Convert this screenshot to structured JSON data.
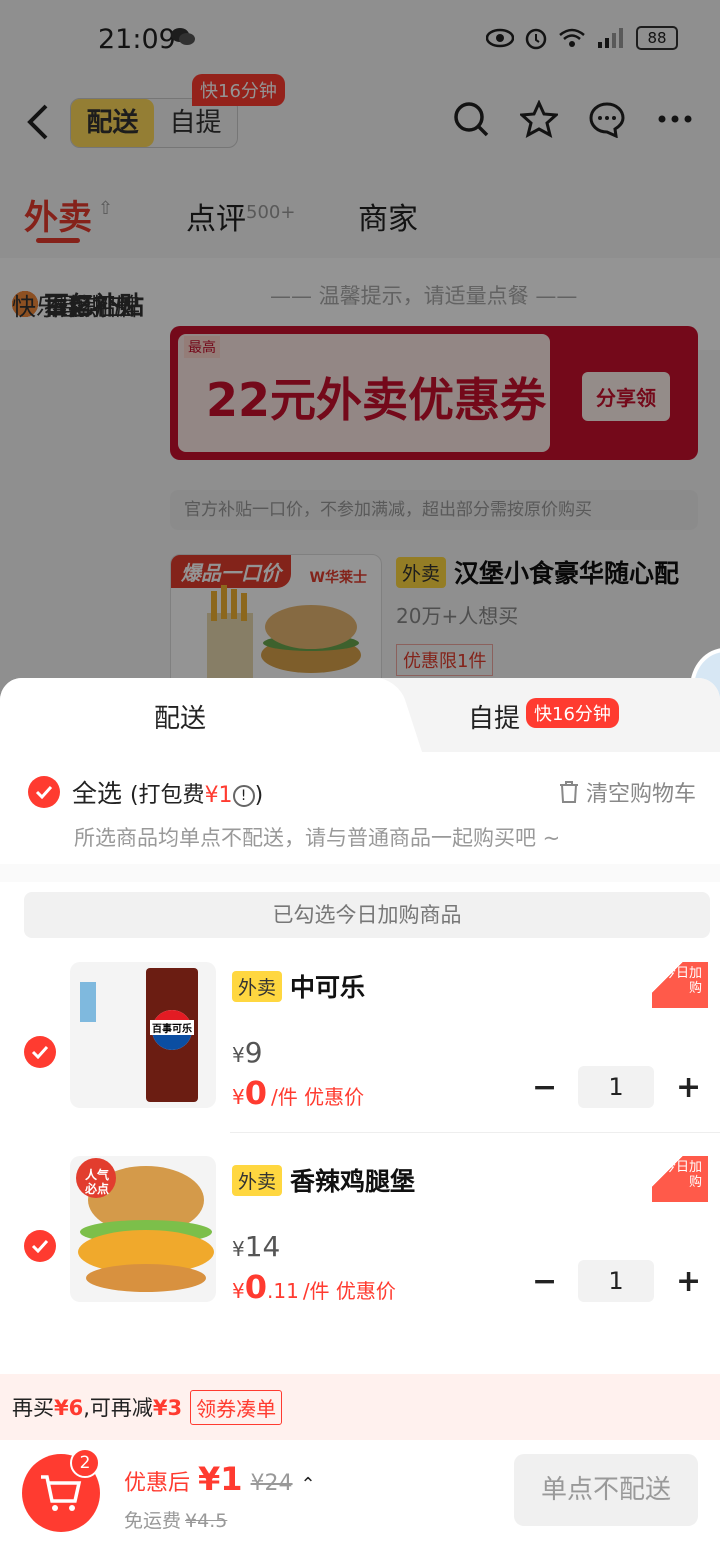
{
  "status": {
    "time": "21:09",
    "battery": "88",
    "network": "4G"
  },
  "header": {
    "mode_delivery": "配送",
    "mode_pickup": "自提",
    "fast_tag": "快16分钟"
  },
  "tabs": [
    {
      "label": "外卖"
    },
    {
      "label": "点评",
      "badge": "500+"
    },
    {
      "label": "商家"
    }
  ],
  "sidebar": {
    "items": [
      {
        "label": "百亿补贴"
      },
      {
        "label": "本店招牌"
      },
      {
        "label": "推荐"
      },
      {
        "label": "折扣"
      },
      {
        "label": "快乐星期五"
      }
    ]
  },
  "store": {
    "tip": "—— 温馨提示，请适量点餐 ——",
    "coupon": {
      "top": "最高",
      "title": "22元外卖优惠券",
      "share": "分享领"
    },
    "rule": "官方补贴一口价，不参加满减，超出部分需按原价购买",
    "product": {
      "ribbon": "爆品一口价",
      "brand": "W华莱士",
      "tag": "外卖",
      "name": "汉堡小食豪华随心配",
      "sub": "20万+人想买",
      "limit": "优惠限1件"
    }
  },
  "sheet": {
    "tab_delivery": "配送",
    "tab_pickup": "自提",
    "tab_pickup_badge": "快16分钟",
    "select_all": "全选",
    "packing_fee_prefix": "(打包费",
    "packing_fee_value": "¥1",
    "packing_fee_suffix": ")",
    "clear": "清空购物车",
    "note": "所选商品均单点不配送，请与普通商品一起购买吧 ~",
    "addon_header": "已勾选今日加购商品",
    "items": [
      {
        "tag": "外卖",
        "name": "中可乐",
        "today_tag": "今日加购",
        "orig_currency": "¥",
        "orig_price": "9",
        "deal_currency": "¥",
        "deal_int": "0",
        "deal_dec": "",
        "unit": "/件 优惠价",
        "qty": "1",
        "thumb_label": "百事可乐"
      },
      {
        "tag": "外卖",
        "name": "香辣鸡腿堡",
        "today_tag": "今日加购",
        "orig_currency": "¥",
        "orig_price": "14",
        "deal_currency": "¥",
        "deal_int": "0",
        "deal_dec": ".11",
        "unit": "/件 优惠价",
        "qty": "1",
        "thumb_label": "人气必点"
      }
    ],
    "promo": {
      "text_1": "再买",
      "amount_1": "¥6",
      "text_2": ",可再减",
      "amount_2": "¥3",
      "button": "领券凑单"
    },
    "checkout": {
      "cart_count": "2",
      "label": "优惠后",
      "price": "¥1",
      "original": "¥24",
      "delivery_label": "免运费",
      "delivery_original": "¥4.5",
      "submit": "单点不配送"
    }
  },
  "colors": {
    "accent": "#ff3b30",
    "brand_yellow": "#ffd95a",
    "coupon_red": "#c8102e"
  }
}
